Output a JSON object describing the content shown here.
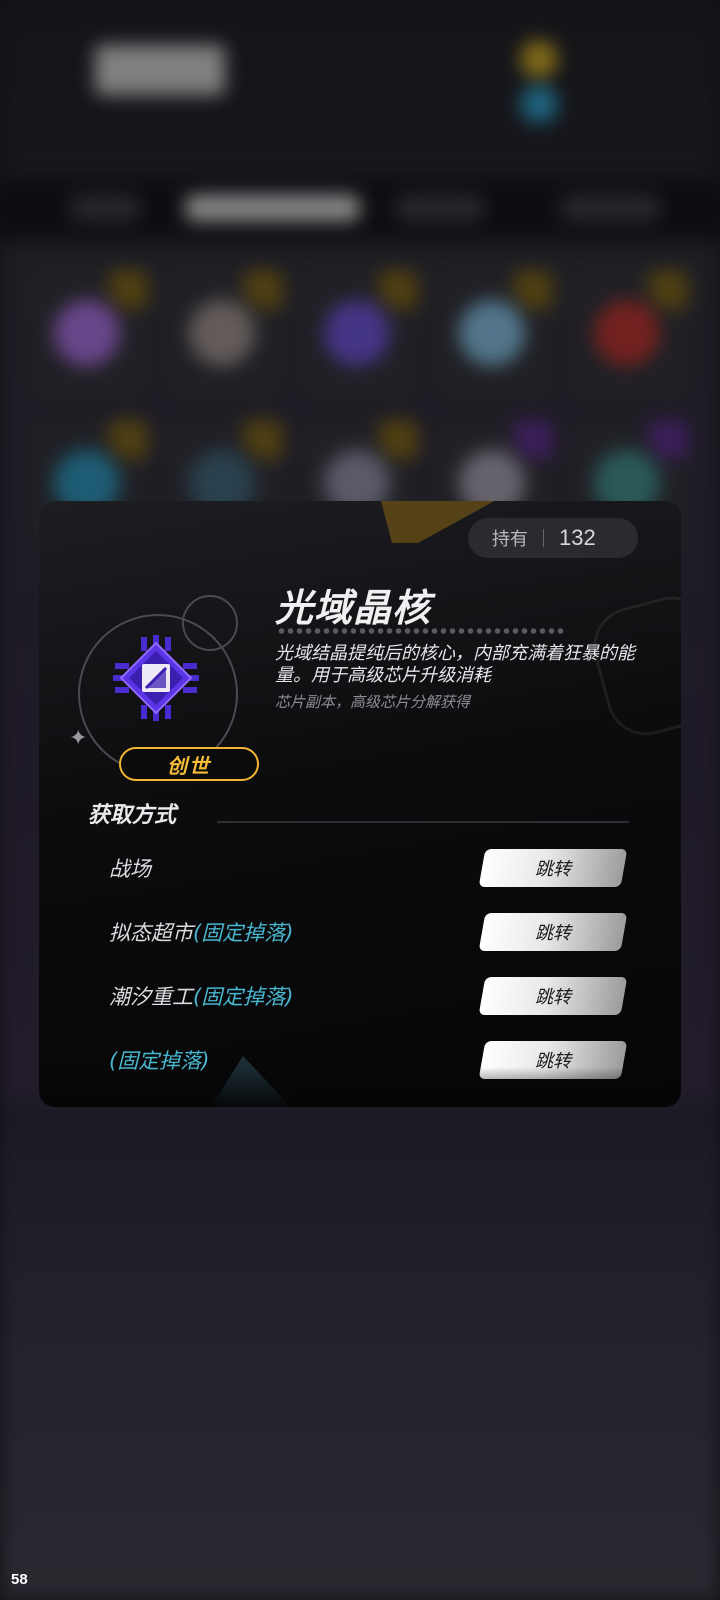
{
  "item": {
    "owned_label": "持有",
    "owned_count": "132",
    "name": "光域晶核",
    "description": "光域结晶提纯后的核心，内部充满着狂暴的能量。用于高级芯片升级消耗",
    "source_hint": "芯片副本，高级芯片分解获得",
    "rarity": "创世",
    "icon": "purple-crystal-chip-icon"
  },
  "acquisition": {
    "title": "获取方式",
    "rows": [
      {
        "name": "战场",
        "tag": "",
        "button": "跳转"
      },
      {
        "name": "拟态超市",
        "tag": "(固定掉落)",
        "button": "跳转"
      },
      {
        "name": "潮汐重工",
        "tag": "(固定掉落)",
        "button": "跳转"
      },
      {
        "name": "",
        "tag": "(固定掉落)",
        "button": "跳转"
      }
    ]
  },
  "fps_counter": "58",
  "colors": {
    "rarity_gold": "#f2b632",
    "tag_cyan": "#49b6cf",
    "modal_bg": "#0c0c0e"
  }
}
